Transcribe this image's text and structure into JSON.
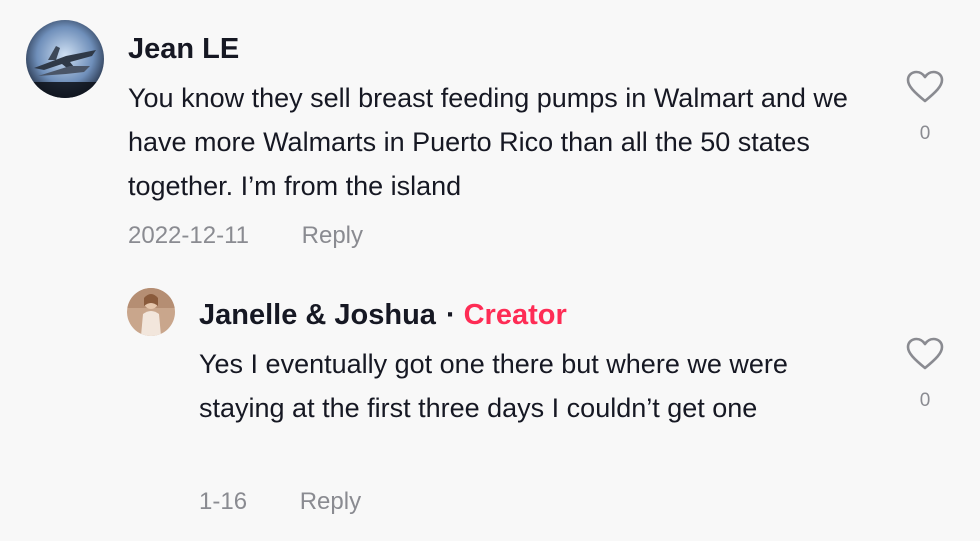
{
  "comments": [
    {
      "author": "Jean LE",
      "text": "You know they sell breast feeding pumps in Walmart and we have more Walmarts in Puerto Rico than all the 50 states together. I’m from the island",
      "date": "2022-12-11",
      "reply_label": "Reply",
      "likes": "0",
      "avatar_icon": "jet-fighter-avatar"
    }
  ],
  "replies": [
    {
      "author": "Janelle & Joshua",
      "separator": "·",
      "badge": "Creator",
      "text": "Yes I eventually got one there but where we were staying at the first three days I couldn’t get one",
      "date": "1-16",
      "reply_label": "Reply",
      "likes": "0",
      "avatar_icon": "person-photo-avatar"
    }
  ],
  "colors": {
    "background": "#f8f8f8",
    "text": "#161823",
    "muted": "#8a8b91",
    "creator_badge": "#fe2c55"
  }
}
